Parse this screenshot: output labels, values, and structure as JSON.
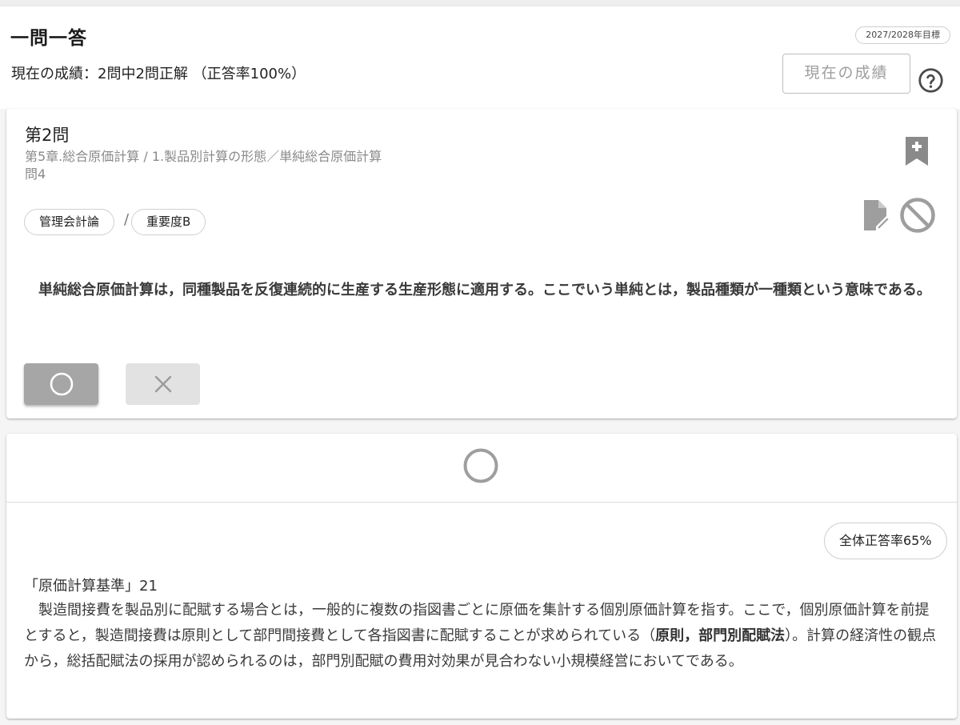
{
  "header": {
    "title": "一問一答",
    "target_badge": "2027/2028年目標",
    "score_text": "現在の成績：2問中2問正解 （正答率100%）",
    "score_button_label": "現在の成績"
  },
  "question": {
    "number": "第2問",
    "chapter": "第5章.総合原価計算 / 1.製品別計算の形態／単純総合原価計算",
    "sub": "問4",
    "tags": [
      "管理会計論",
      "重要度B"
    ],
    "tag_separator": "/",
    "body": "単純総合原価計算は，同種製品を反復連続的に生産する生産形態に適用する。ここでいう単純とは，製品種類が一種類という意味である。",
    "answer_maru": "○",
    "answer_batsu": "×"
  },
  "result": {
    "mark": "○",
    "overall_rate": "全体正答率65%",
    "reference": "「原価計算基準」21",
    "explanation_before": "製造間接費を製品別に配賦する場合とは，一般的に複数の指図書ごとに原価を集計する個別原価計算を指す。ここで，個別原価計算を前提とすると，製造間接費は原則として部門間接費として各指図書に配賦することが求められている（",
    "explanation_bold": "原則，部門別配賦法",
    "explanation_after": "）。計算の経済性の観点から，総括配賦法の採用が認められるのは，部門別配賦の費用対効果が見合わない小規模経営においてである。"
  },
  "colors": {
    "background": "#f5f5f5",
    "card": "#ffffff",
    "icon_gray": "#9e9e9e",
    "button_selected": "#a6a6a6",
    "button_unselected": "#e2e2e2"
  },
  "icons": {
    "help": "help-circle-icon",
    "bookmark": "bookmark-add-icon",
    "edit": "edit-note-icon",
    "ban": "ban-icon",
    "maru": "circle-icon",
    "batsu": "cross-icon"
  }
}
